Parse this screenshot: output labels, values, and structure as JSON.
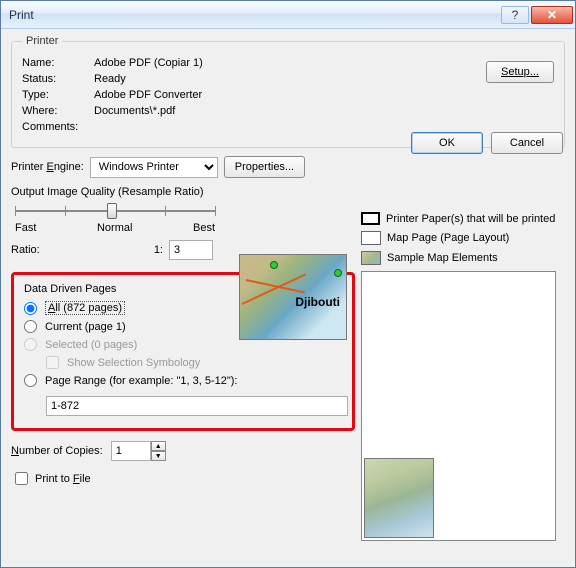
{
  "window": {
    "title": "Print"
  },
  "titlebar_icons": {
    "help": "?",
    "close": "✕"
  },
  "printer": {
    "legend": "Printer",
    "name_label": "Name:",
    "name_value": "Adobe PDF (Copiar 1)",
    "status_label": "Status:",
    "status_value": "Ready",
    "type_label": "Type:",
    "type_value": "Adobe PDF Converter",
    "where_label": "Where:",
    "where_value": "Documents\\*.pdf",
    "comments_label": "Comments:",
    "comments_value": "",
    "setup_button": "Setup..."
  },
  "engine": {
    "label_pre": "Printer ",
    "label_u": "E",
    "label_post": "ngine:",
    "value": "Windows Printer",
    "properties_button": "Properties..."
  },
  "quality": {
    "heading": "Output Image Quality (Resample Ratio)",
    "fast": "Fast",
    "normal": "Normal",
    "best": "Best",
    "ratio_label": "Ratio:",
    "ratio_prefix": "1:",
    "ratio_value": "3"
  },
  "map_label": "Djibouti",
  "legend": {
    "printed": "Printer Paper(s) that will be printed",
    "layout": "Map Page (Page Layout)",
    "elements": "Sample Map Elements"
  },
  "ddp": {
    "heading": "Data Driven Pages",
    "all_pre": "A",
    "all_post": "ll (872 pages)",
    "current": "Current (page 1)",
    "selected": "Selected (0 pages)",
    "show_sel": "Show Selection Symbology",
    "range": "Page Range (for example: \"1, 3, 5-12\"):",
    "range_value": "1-872"
  },
  "copies": {
    "label_pre": "N",
    "label_post": "umber of Copies:",
    "value": "1"
  },
  "printfile": {
    "label_pre": "Print to ",
    "label_u": "F",
    "label_post": "ile"
  },
  "buttons": {
    "ok": "OK",
    "cancel": "Cancel"
  }
}
